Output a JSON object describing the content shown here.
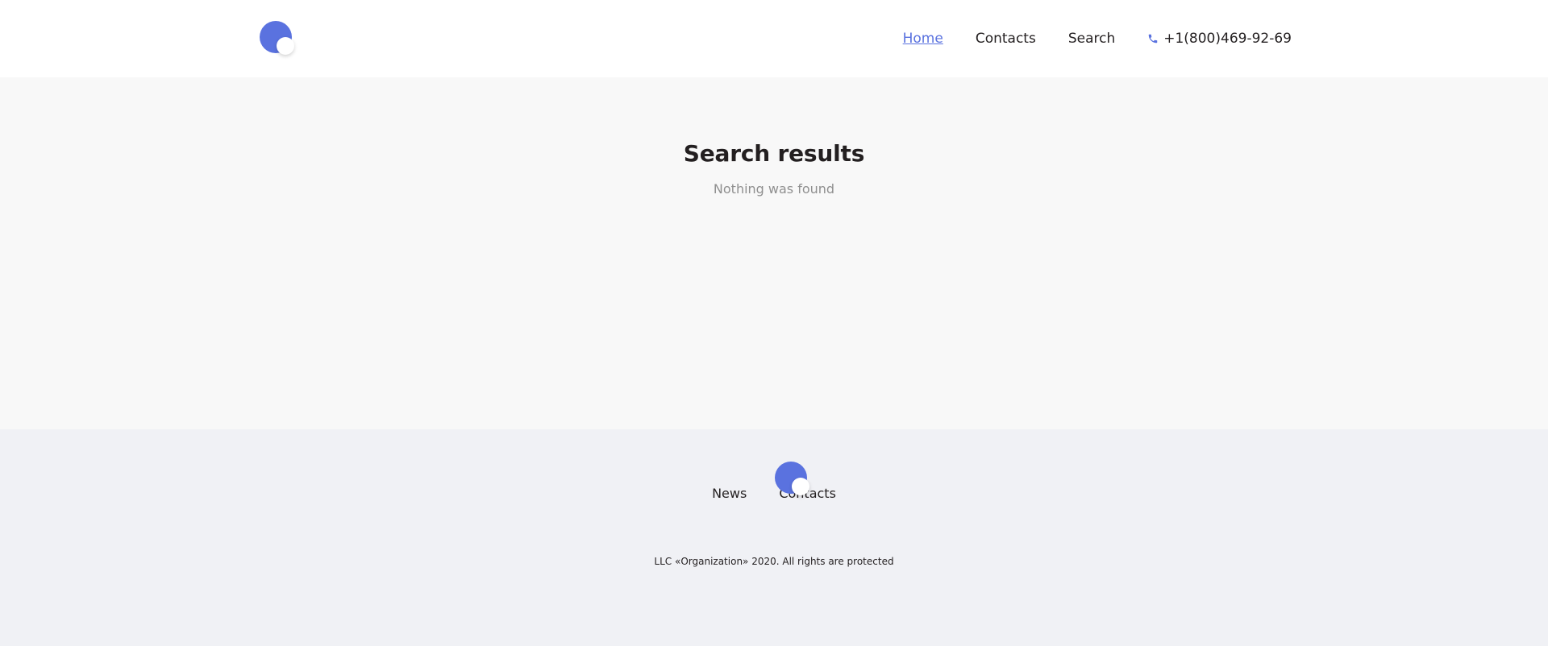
{
  "header": {
    "nav": [
      {
        "label": "Home",
        "active": true
      },
      {
        "label": "Contacts",
        "active": false
      },
      {
        "label": "Search",
        "active": false
      }
    ],
    "phone": "+1(800)469-92-69"
  },
  "main": {
    "title": "Search results",
    "message": "Nothing was found"
  },
  "footer": {
    "nav": [
      {
        "label": "News"
      },
      {
        "label": "Contacts"
      }
    ],
    "copyright": "LLC «Organization» 2020. All rights are protected"
  },
  "colors": {
    "accent": "#5a72df",
    "main_bg": "#f8f8f8",
    "footer_bg": "#f0f1f5",
    "text": "#231f20",
    "muted": "#8f8f8f"
  },
  "icons": {
    "logo": "logo-icon",
    "phone": "phone-icon"
  }
}
